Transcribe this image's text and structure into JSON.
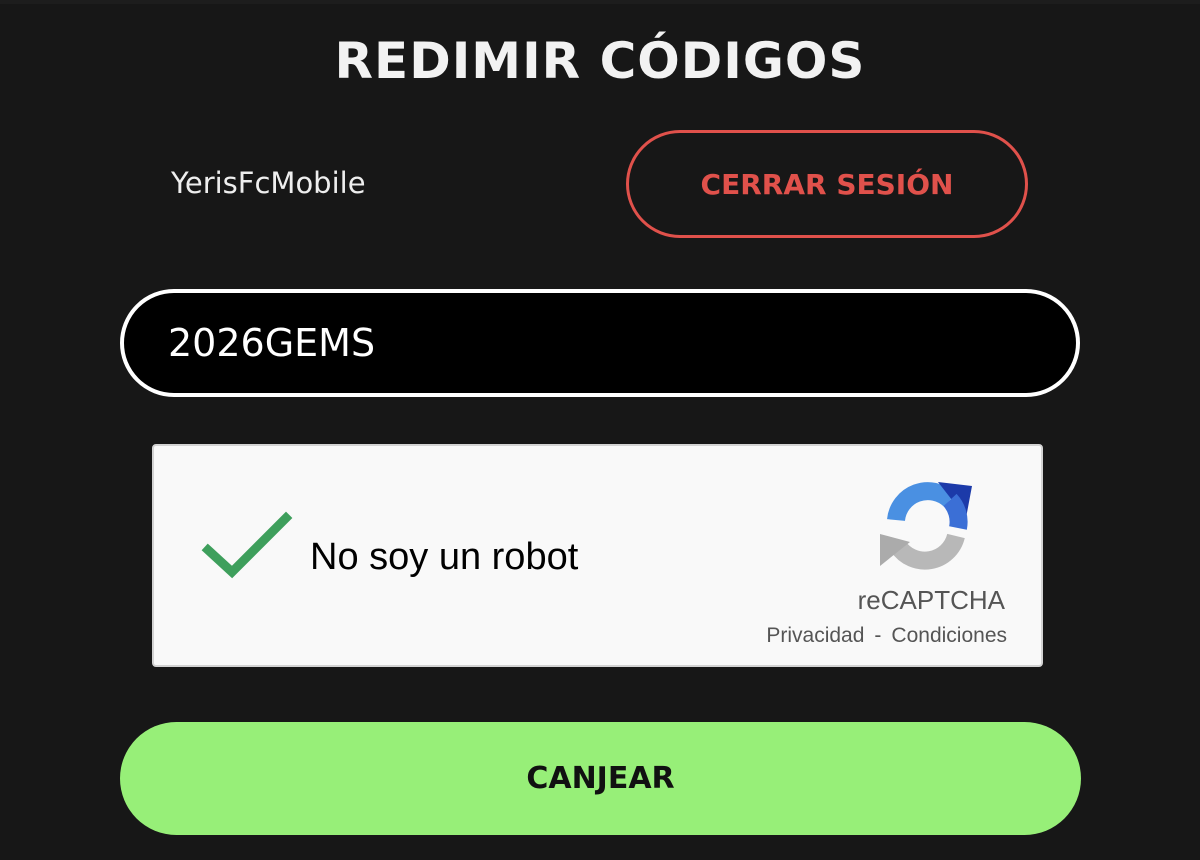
{
  "header": {
    "title": "REDIMIR CÓDIGOS"
  },
  "account": {
    "username": "YerisFcMobile",
    "logout_label": "CERRAR SESIÓN"
  },
  "code_field": {
    "value": "2026GEMS"
  },
  "captcha": {
    "checked": true,
    "label": "No soy un robot",
    "brand": "reCAPTCHA",
    "privacy_label": "Privacidad",
    "separator": "-",
    "terms_label": "Condiciones",
    "check_icon": "checkmark-icon",
    "logo_icon": "recaptcha-logo-icon"
  },
  "actions": {
    "redeem_label": "CANJEAR"
  },
  "colors": {
    "background": "#171717",
    "logout_accent": "#e0514b",
    "redeem_button": "#97ef78",
    "checkmark": "#3e9f5c"
  }
}
